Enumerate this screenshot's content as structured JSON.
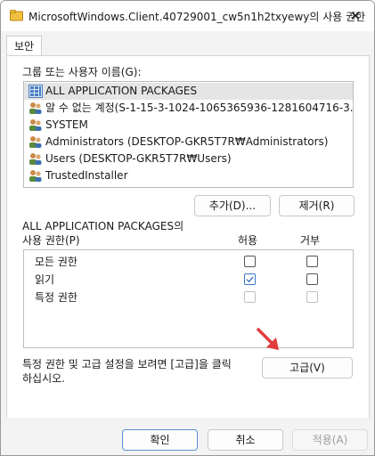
{
  "window": {
    "title": "MicrosoftWindows.Client.40729001_cw5n1h2txyewy의 사용 권한",
    "close_glyph": "✕"
  },
  "tabs": [
    {
      "label": "보안"
    }
  ],
  "groups": {
    "label": "그룹 또는 사용자 이름(G):",
    "items": [
      {
        "label": "ALL APPLICATION PACKAGES",
        "icon": "app-packages-icon",
        "selected": true
      },
      {
        "label": "알 수 없는 계정(S-1-15-3-1024-1065365936-1281604716-3...",
        "icon": "user-group-icon",
        "selected": false
      },
      {
        "label": "SYSTEM",
        "icon": "user-group-icon",
        "selected": false
      },
      {
        "label": "Administrators (DESKTOP-GKR5T7R₩Administrators)",
        "icon": "user-group-icon",
        "selected": false
      },
      {
        "label": "Users (DESKTOP-GKR5T7R₩Users)",
        "icon": "user-group-icon",
        "selected": false
      },
      {
        "label": "TrustedInstaller",
        "icon": "user-group-icon",
        "selected": false
      }
    ],
    "add_label": "추가(D)...",
    "remove_label": "제거(R)"
  },
  "permissions": {
    "label_line1": "ALL APPLICATION PACKAGES의",
    "label_line2": "사용 권한(P)",
    "allow_header": "허용",
    "deny_header": "거부",
    "rows": [
      {
        "label": "모든 권한",
        "allow": "unchecked",
        "deny": "unchecked"
      },
      {
        "label": "읽기",
        "allow": "checked",
        "deny": "unchecked"
      },
      {
        "label": "특정 권한",
        "allow": "disabled",
        "deny": "disabled"
      }
    ]
  },
  "advanced": {
    "text_line1": "특정 권한 및 고급 설정을 보려면 [고급]을 클릭",
    "text_line2": "하십시오.",
    "button_label": "고급(V)"
  },
  "footer": {
    "ok_label": "확인",
    "cancel_label": "취소",
    "apply_label": "적용(A)"
  },
  "colors": {
    "accent": "#3a78c8",
    "arrow": "#e03c3c",
    "selection": "#e5e5e5"
  }
}
